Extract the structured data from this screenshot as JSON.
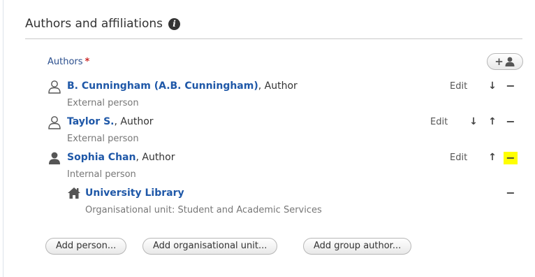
{
  "section": {
    "title": "Authors and affiliations",
    "info_icon": "info-icon"
  },
  "authors": {
    "label": "Authors",
    "required_marker": "*",
    "add_author_icon": "add-person-icon",
    "add_author_plus": "+",
    "rows": [
      {
        "name": "B. Cunningham (A.B. Cunningham)",
        "role": ", Author",
        "type": "External person",
        "edit": "Edit",
        "icon": "person-outline-icon"
      },
      {
        "name": "Taylor S.",
        "role": ", Author",
        "type": "External person",
        "edit": "Edit",
        "icon": "person-outline-icon"
      },
      {
        "name": "Sophia Chan",
        "role": ", Author",
        "type": "Internal person",
        "edit": "Edit",
        "icon": "person-filled-icon"
      }
    ],
    "org_unit": {
      "name": "University Library",
      "detail": "Organisational unit: Student and Academic Services",
      "icon": "home-icon"
    }
  },
  "controls": {
    "down": "↓",
    "up": "↑",
    "remove": "−"
  },
  "buttons": {
    "add_person": "Add person...",
    "add_org_unit": "Add organisational unit...",
    "add_group_author": "Add group author..."
  },
  "colors": {
    "link": "#1f58a8",
    "label": "#2b4f8e",
    "required": "#cc2b2b",
    "highlight": "#ffff00"
  }
}
